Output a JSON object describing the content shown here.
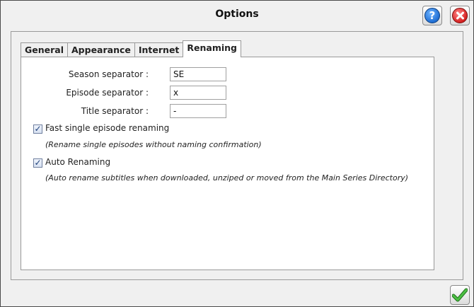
{
  "window": {
    "title": "Options"
  },
  "toolbar": {
    "help_icon": "?",
    "close_icon": "close-icon"
  },
  "tabs": [
    {
      "label": "General",
      "active": false
    },
    {
      "label": "Appearance",
      "active": false
    },
    {
      "label": "Internet",
      "active": false
    },
    {
      "label": "Renaming",
      "active": true
    }
  ],
  "renaming": {
    "season_label": "Season separator :",
    "season_value": "SE",
    "episode_label": "Episode separator :",
    "episode_value": "x",
    "title_label": "Title separator :",
    "title_value": "-",
    "fast_label": "Fast single episode renaming",
    "fast_checked": true,
    "fast_hint": "(Rename single episodes without naming confirmation)",
    "auto_label": "Auto Renaming",
    "auto_checked": true,
    "auto_hint": "(Auto rename subtitles when downloaded, unziped or moved from the Main Series Directory)"
  },
  "colors": {
    "accent_ok": "#3aa535",
    "help": "#1f6ed4",
    "close": "#d62020"
  }
}
